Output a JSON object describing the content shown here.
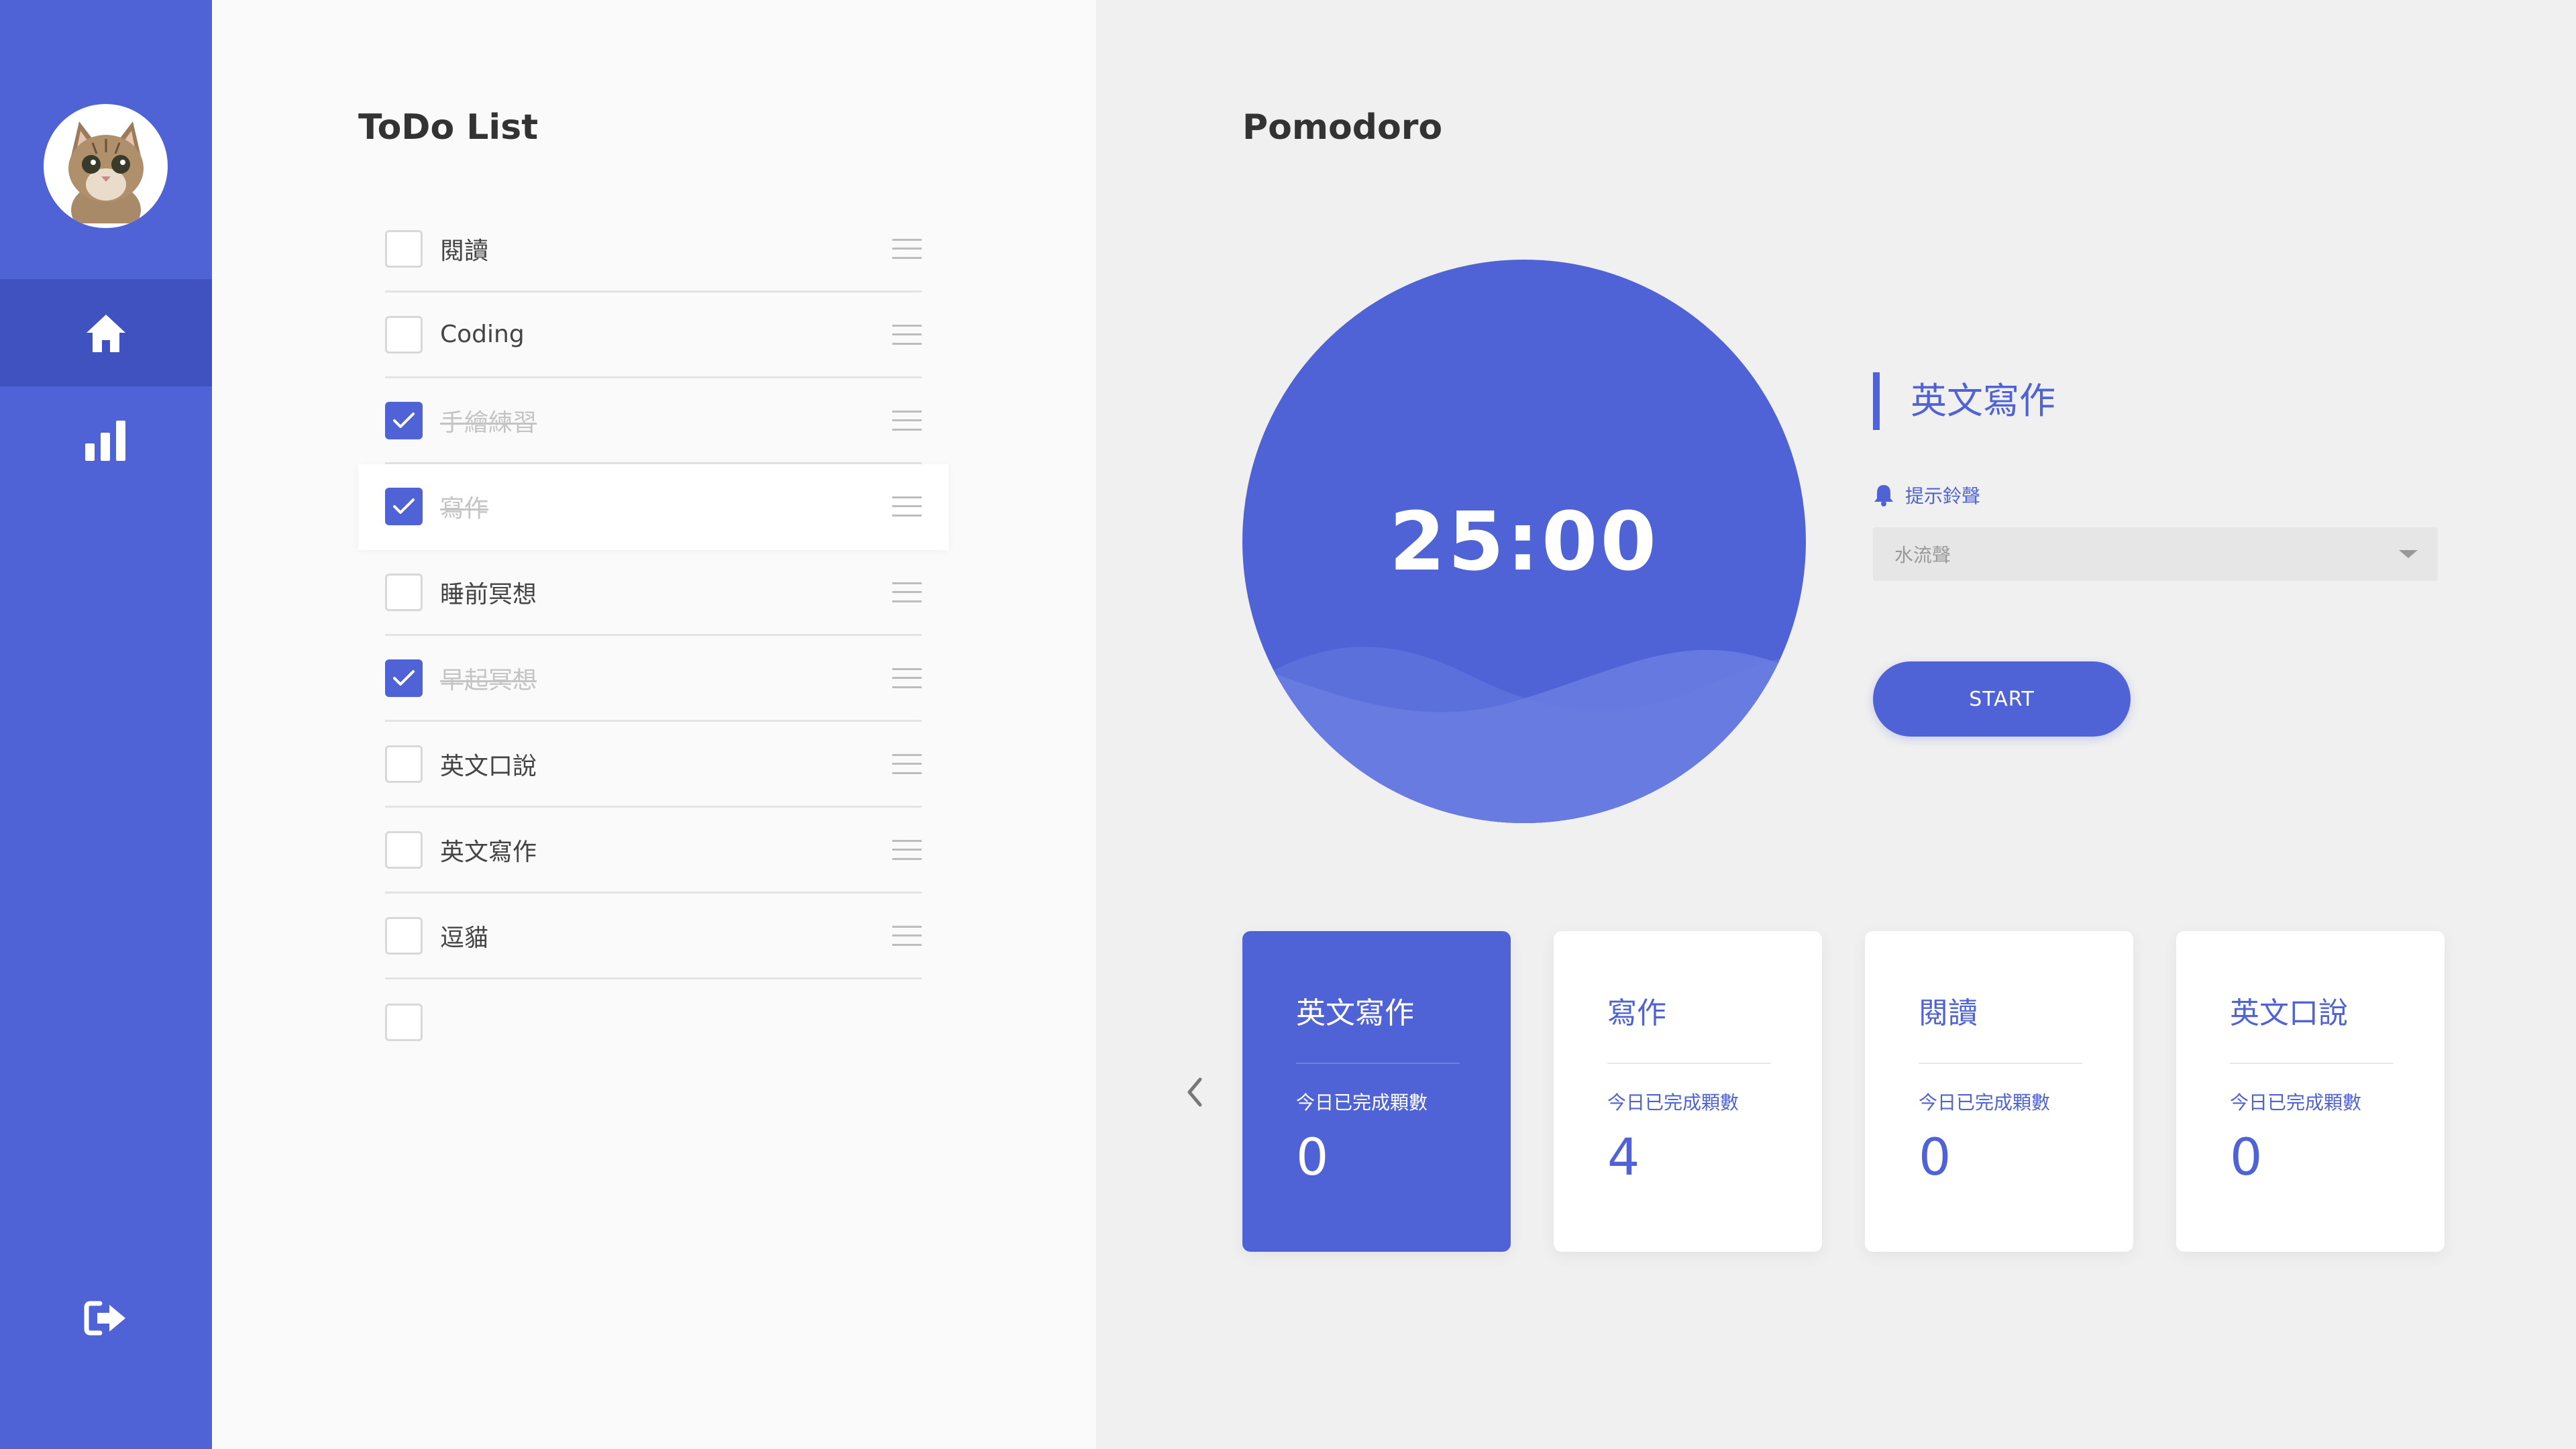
{
  "sidebar": {
    "avatar_icon": "cat-avatar",
    "nav": [
      {
        "name": "home",
        "icon": "home-icon",
        "active": true
      },
      {
        "name": "stats",
        "icon": "bar-chart-icon",
        "active": false
      }
    ],
    "logout_icon": "logout-icon"
  },
  "todo": {
    "title": "ToDo List",
    "items": [
      {
        "label": "閱讀",
        "done": false
      },
      {
        "label": "Coding",
        "done": false
      },
      {
        "label": "手繪練習",
        "done": true
      },
      {
        "label": "寫作",
        "done": true
      },
      {
        "label": "睡前冥想",
        "done": false
      },
      {
        "label": "早起冥想",
        "done": true
      },
      {
        "label": "英文口說",
        "done": false
      },
      {
        "label": "英文寫作",
        "done": false
      },
      {
        "label": "逗貓",
        "done": false
      },
      {
        "label": "",
        "done": false
      }
    ]
  },
  "pomodoro": {
    "title": "Pomodoro",
    "timer": "25:00",
    "current_task": "英文寫作",
    "alarm_label": "提示鈴聲",
    "alarm_value": "水流聲",
    "start_label": "START",
    "cards": [
      {
        "title": "英文寫作",
        "subtitle": "今日已完成顆數",
        "count": "0",
        "selected": true
      },
      {
        "title": "寫作",
        "subtitle": "今日已完成顆數",
        "count": "4",
        "selected": false
      },
      {
        "title": "閱讀",
        "subtitle": "今日已完成顆數",
        "count": "0",
        "selected": false
      },
      {
        "title": "英文口說",
        "subtitle": "今日已完成顆數",
        "count": "0",
        "selected": false
      }
    ]
  },
  "colors": {
    "primary": "#4f63d6",
    "sidebar_active": "#3f52bf",
    "panel_light": "#fafafa",
    "panel_gray": "#f0f0f0"
  }
}
